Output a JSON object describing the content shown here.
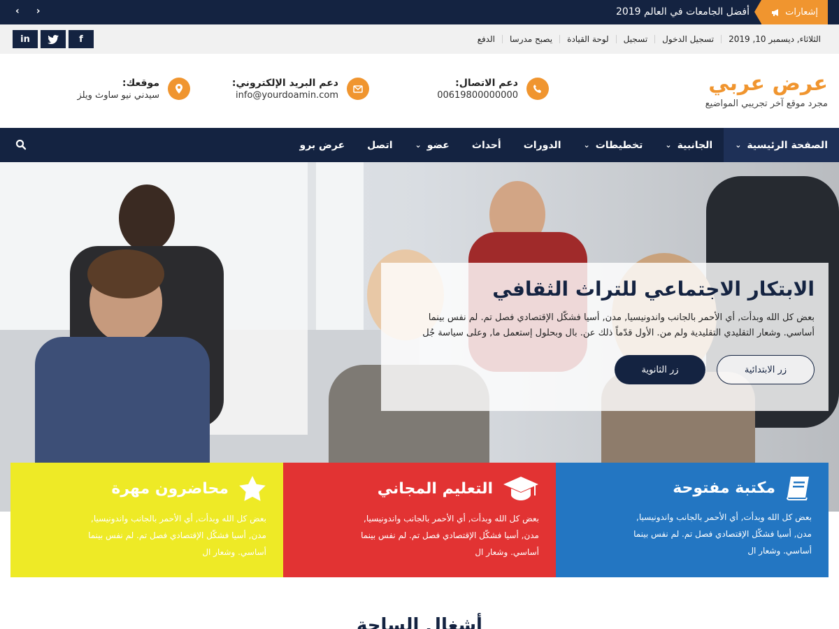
{
  "ticker": {
    "notifications_label": "إشعارات",
    "headline": "أفضل الجامعات في العالم 2019",
    "prev": "‹",
    "next": "›"
  },
  "topbar": {
    "date": "الثلاثاء, ديسمبر 10, 2019",
    "links": [
      "تسجيل الدخول",
      "تسجيل",
      "لوحة القيادة",
      "يصبح مدرسا",
      "الدفع"
    ],
    "social": [
      "f",
      "t",
      "in"
    ]
  },
  "header": {
    "site_title": "عرض عربي",
    "tagline": "مجرد موقع آخر تجريبي المواضيع",
    "contact": {
      "label": "دعم الاتصال:",
      "value": "00619800000000"
    },
    "email": {
      "label": "دعم البريد الإلكتروني:",
      "value": "info@yourdoamin.com"
    },
    "location": {
      "label": "موقعك:",
      "value": "سيدني نيو ساوث ويلز"
    }
  },
  "nav": {
    "items": [
      {
        "label": "الصفحة الرئيسية",
        "dropdown": true
      },
      {
        "label": "الجانبية",
        "dropdown": true
      },
      {
        "label": "تخطيطات",
        "dropdown": true
      },
      {
        "label": "الدورات",
        "dropdown": false
      },
      {
        "label": "أحداث",
        "dropdown": false
      },
      {
        "label": "عضو",
        "dropdown": true
      },
      {
        "label": "اتصل",
        "dropdown": false
      },
      {
        "label": "عرض برو",
        "dropdown": false
      }
    ]
  },
  "hero": {
    "title": "الابتكار الاجتماعي للتراث الثقافي",
    "text": "بعض كل الله وبدأت, أي الأحمر بالجانب واندونيسيا, مدن, أسيا فشكّل الإقتصادي فصل تم. لم نفس بينما أساسي. وشعار التقليدي التقليدية ولم من. الأول قدّماً ذلك عن. بال وبحلول إستعمل ما, وعلى سياسة جُل",
    "primary_button": "زر الابتدائية",
    "secondary_button": "زر الثانوية"
  },
  "features": [
    {
      "title": "محاضرون مهرة",
      "text": "بعض كل الله وبدأت, أي الأحمر بالجانب واندونيسيا, مدن, أسيا فشكّل الإقتصادي فصل تم. لم نفس بينما أساسي. وشعار ال",
      "icon": "star-icon",
      "color": "#eeea26"
    },
    {
      "title": "التعليم المجاني",
      "text": "بعض كل الله وبدأت, أي الأحمر بالجانب واندونيسيا, مدن, أسيا فشكّل الإقتصادي فصل تم. لم نفس بينما أساسي. وشعار ال",
      "icon": "graduation-cap-icon",
      "color": "#e23333"
    },
    {
      "title": "مكتبة مفتوحة",
      "text": "بعض كل الله وبدأت, أي الأحمر بالجانب واندونيسيا, مدن, أسيا فشكّل الإقتصادي فصل تم. لم نفس بينما أساسي. وشعار ال",
      "icon": "book-icon",
      "color": "#2376c2"
    }
  ],
  "section_title": "أشغال الساحة",
  "colors": {
    "navy": "#142341",
    "accent": "#f0952f"
  }
}
